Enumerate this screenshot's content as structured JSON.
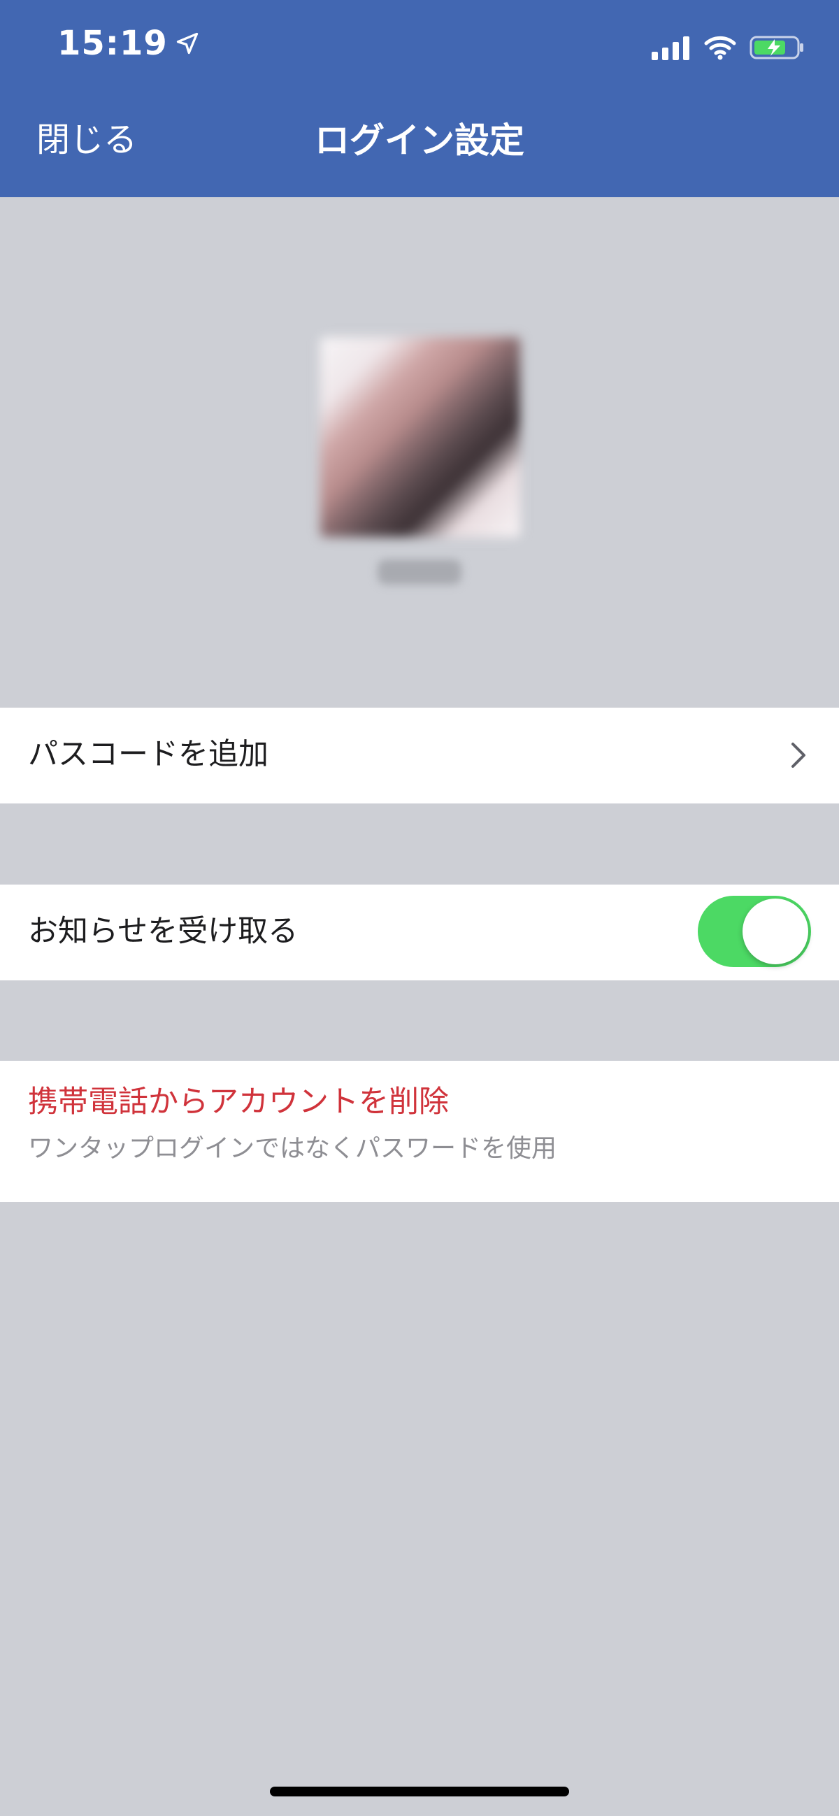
{
  "status_bar": {
    "time": "15:19",
    "location_icon": "location-arrow-icon",
    "signal_icon": "cellular-signal-icon",
    "wifi_icon": "wifi-icon",
    "battery_icon": "battery-charging-icon"
  },
  "nav": {
    "close_label": "閉じる",
    "title": "ログイン設定"
  },
  "settings": {
    "passcode_label": "パスコードを追加",
    "notifications_label": "お知らせを受け取る",
    "notifications_enabled": true,
    "remove_title": "携帯電話からアカウントを削除",
    "remove_subtitle": "ワンタップログインではなくパスワードを使用"
  },
  "colors": {
    "header": "#4267b2",
    "background": "#cdcfd5",
    "toggle_on": "#4cd964",
    "destructive": "#d0333b"
  }
}
